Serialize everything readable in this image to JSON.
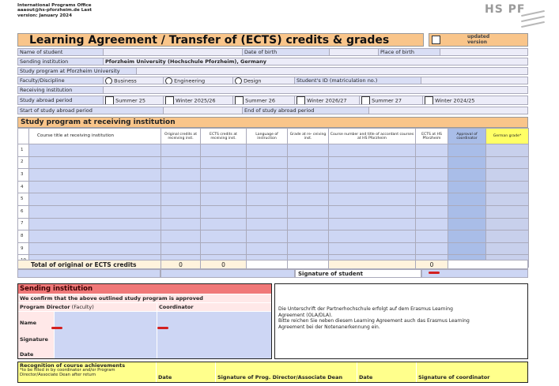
{
  "header": {
    "line1": "International Programs Office",
    "line2": "aaaout@hs-pforzheim.de Last",
    "line3": "version: January 2024"
  },
  "logo": {
    "text": "HS PF"
  },
  "title": "Learning Agreement / Transfer of (ECTS) credits & grades",
  "updated": {
    "l1": "updated",
    "l2": "version"
  },
  "info": {
    "name_of_student": "Name of student",
    "date_of_birth": "Date of birth",
    "place_of_birth": "Place of birth",
    "sending_institution": "Sending institution",
    "sending_value": "Pforzheim University (Hochschule Pforzheim), Germany",
    "study_program": "Study program at Pforzheim University",
    "faculty": "Faculty/Discipline",
    "fac_business": "Business",
    "fac_engineering": "Engineering",
    "fac_design": "Design",
    "student_id": "Student's ID (matriculation no.)",
    "receiving": "Receiving institution",
    "abroad_period": "Study abroad period",
    "start": "Start of study abroad period",
    "end": "End of study abroad period"
  },
  "periods": [
    "Summer 25",
    "Winter 2025/26",
    "Summer 26",
    "Winter 2026/27",
    "Summer 27",
    "Winter 2024/25"
  ],
  "section_title": "Study program at receiving institution",
  "columns": [
    "Course title at receiving institution",
    "Original credits at receiving inst.",
    "ECTS credits at receiving inst.",
    "Language of instruction",
    "Grade at re- ceiving inst.",
    "Course number and title of accordant courses at HS Pforzheim",
    "ECTS at HS Pforzheim",
    "Approval of coordinator",
    "German grade*"
  ],
  "row_numbers": [
    "1",
    "2",
    "3",
    "4",
    "5",
    "6",
    "7",
    "8",
    "9",
    "10"
  ],
  "totals": {
    "label": "Total of original or ECTS credits",
    "orig": "0",
    "ects": "0",
    "hs": "0"
  },
  "signature_student": "Signature of student",
  "sending": {
    "title": "Sending institution",
    "confirm": "We confirm that the above outlined study program is approved",
    "director": "Program Director",
    "director_sub": "(Faculty)",
    "coordinator": "Coordinator",
    "name": "Name",
    "signature": "Signature",
    "date": "Date"
  },
  "note": {
    "l1": "Die Unterschrift der Partnerhochschule erfolgt auf dem Erasmus Learning",
    "l2": "Agreement (OLA/DLA).",
    "l3": "Bitte reichen Sie neben diesem Learning Agreement auch das Erasmus Learning",
    "l4": "Agreement bei der Notenanerkennung ein."
  },
  "recognition": {
    "title": "Recognition of course achievements",
    "sub": "*to be filled in by coordinator and/or Program Director/Associate Dean after return",
    "date": "Date",
    "sig_dean": "Signature of Prog. Director/Associate Dean",
    "date2": "Date",
    "sig_coord": "Signature of coordinator"
  },
  "colors": {
    "orange": "#f9c58a",
    "label_blue": "#d9def5",
    "cell_blue": "#cdd6f4",
    "approval": "#a9bde8",
    "red": "#f07878",
    "yellow": "#ffff8c",
    "german_grade": "#ffff66",
    "pointer": "#d32020"
  }
}
